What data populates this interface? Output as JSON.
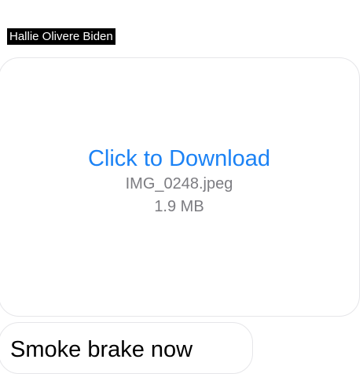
{
  "sender": {
    "name": "Hallie Olivere Biden"
  },
  "attachment": {
    "action_label": "Click to Download",
    "file_name": "IMG_0248.jpeg",
    "file_size": "1.9 MB",
    "accent_color": "#1b82f5"
  },
  "message": {
    "text": "Smoke brake now"
  }
}
